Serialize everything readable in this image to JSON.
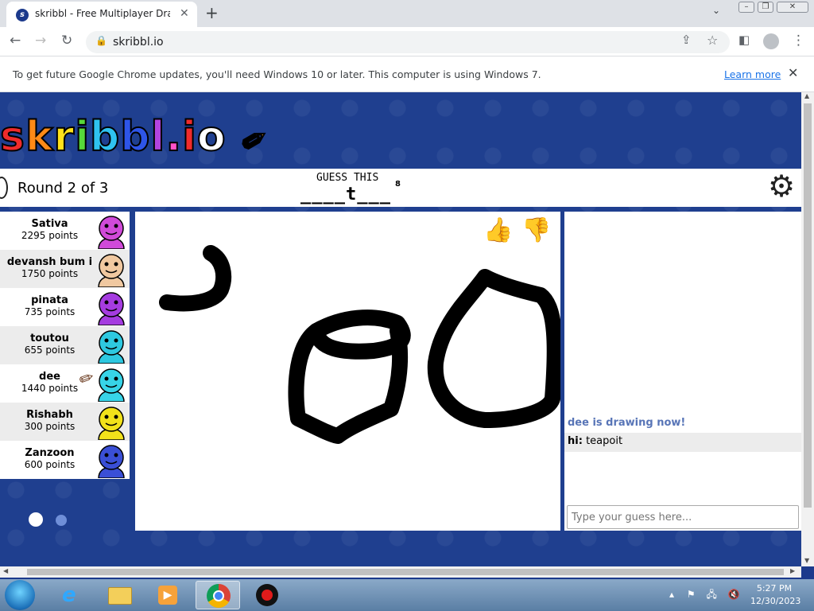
{
  "browser": {
    "tab_title": "skribbl - Free Multiplayer Drawing",
    "tab_close": "✕",
    "new_tab": "+",
    "tab_menu": "⌄",
    "url": "skribbl.io"
  },
  "infobar": {
    "message": "To get future Google Chrome updates, you'll need Windows 10 or later. This computer is using Windows 7.",
    "link": "Learn more",
    "close": "✕"
  },
  "game": {
    "logo": "skribbl.io",
    "round": "Round 2 of 3",
    "guess_label": "GUESS THIS",
    "word_hint": "____t___",
    "word_length": "8",
    "players": [
      {
        "name": "Sativa",
        "points": "2295 points",
        "color": "#d04ad9"
      },
      {
        "name": "devansh bum i",
        "points": "1750 points",
        "color": "#f0c8a0"
      },
      {
        "name": "pinata",
        "points": "735 points",
        "color": "#a53ce0"
      },
      {
        "name": "toutou",
        "points": "655 points",
        "color": "#2ec8e0"
      },
      {
        "name": "dee",
        "points": "1440 points",
        "color": "#37d4e8",
        "drawing": true
      },
      {
        "name": "Rishabh",
        "points": "300 points",
        "color": "#f2e21a"
      },
      {
        "name": "Zanzoon",
        "points": "600 points",
        "color": "#3a4fd6"
      }
    ],
    "chat": {
      "system_message": "dee is drawing now!",
      "messages": [
        {
          "user": "hi:",
          "text": "teapoit"
        }
      ],
      "input_placeholder": "Type your guess here..."
    }
  },
  "taskbar": {
    "time": "5:27 PM",
    "date": "12/30/2023"
  }
}
